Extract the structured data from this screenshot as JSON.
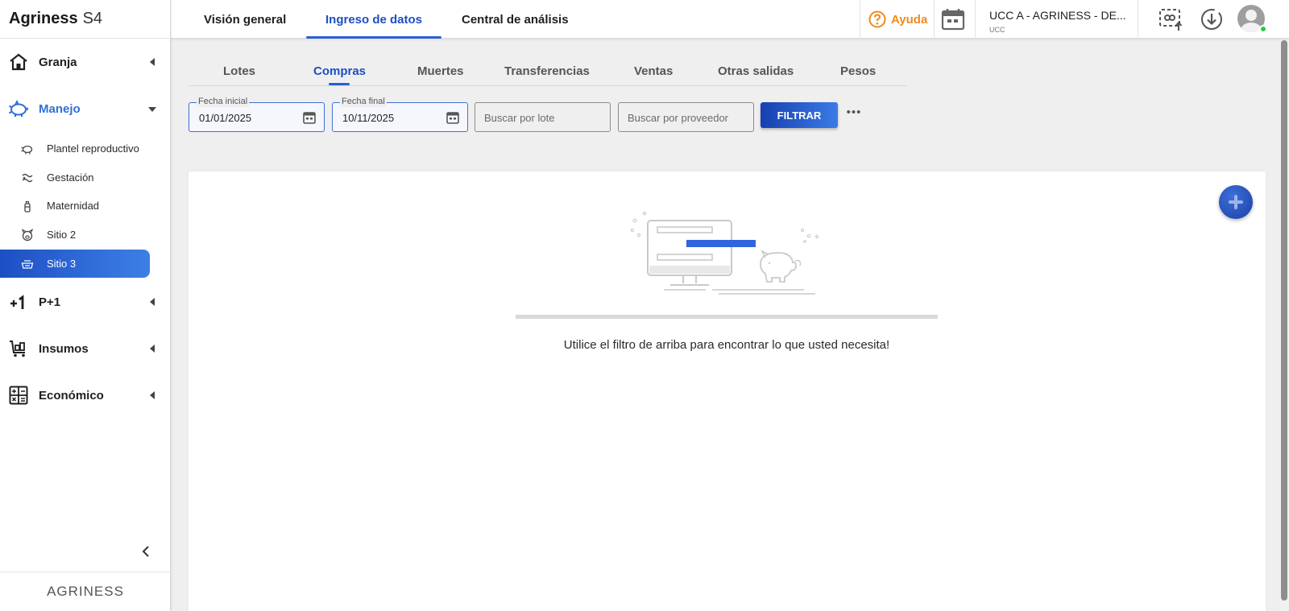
{
  "app": {
    "brand": "Agriness",
    "version": "S4",
    "footer_logo": "AGRINESS"
  },
  "sidebar": {
    "groups": [
      {
        "label": "Granja",
        "icon": "house-icon"
      },
      {
        "label": "Manejo",
        "icon": "pig-icon",
        "expanded": true
      },
      {
        "label": "P+1",
        "icon": "plus-one-icon"
      },
      {
        "label": "Insumos",
        "icon": "cart-icon"
      },
      {
        "label": "Económico",
        "icon": "calculator-icon"
      }
    ],
    "manejo_items": [
      {
        "label": "Plantel reproductivo",
        "icon": "pig-outline-icon"
      },
      {
        "label": "Gestación",
        "icon": "gestation-icon"
      },
      {
        "label": "Maternidad",
        "icon": "bottle-icon"
      },
      {
        "label": "Sitio 2",
        "icon": "pig-face-icon"
      },
      {
        "label": "Sitio 3",
        "icon": "feeder-icon",
        "active": true
      }
    ]
  },
  "topbar": {
    "tabs": [
      {
        "label": "Visión general"
      },
      {
        "label": "Ingreso de datos",
        "active": true
      },
      {
        "label": "Central de análisis"
      }
    ],
    "help_label": "Ayuda",
    "farm_name": "UCC A - AGRINESS - DE...",
    "farm_subtitle": "UCC"
  },
  "subtabs": [
    {
      "label": "Lotes"
    },
    {
      "label": "Compras",
      "active": true
    },
    {
      "label": "Muertes"
    },
    {
      "label": "Transferencias"
    },
    {
      "label": "Ventas"
    },
    {
      "label": "Otras salidas"
    },
    {
      "label": "Pesos"
    }
  ],
  "filters": {
    "start_date": {
      "label": "Fecha inicial",
      "value": "01/01/2025"
    },
    "end_date": {
      "label": "Fecha final",
      "value": "10/11/2025"
    },
    "lot_search": {
      "placeholder": "Buscar por lote"
    },
    "supplier_search": {
      "placeholder": "Buscar por proveedor"
    },
    "filter_button": "FILTRAR",
    "more": "•••"
  },
  "empty_state": {
    "message": "Utilice el filtro de arriba para encontrar lo que usted necesita!"
  },
  "colors": {
    "accent": "#1d4fc4",
    "help": "#f08a1c",
    "online": "#2ecc40"
  }
}
